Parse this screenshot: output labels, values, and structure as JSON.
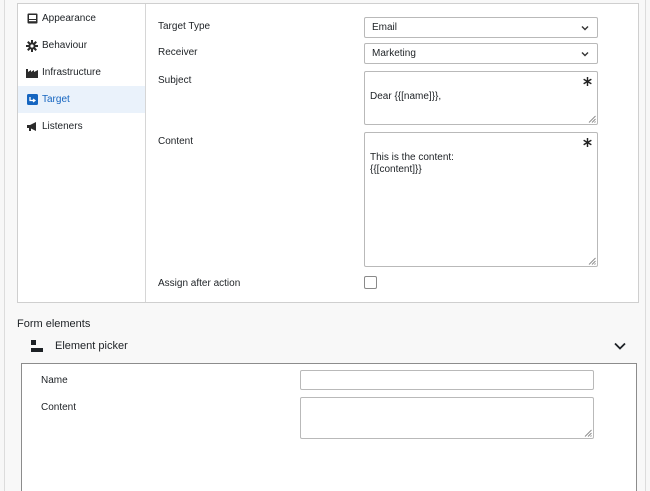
{
  "sidebar": {
    "items": [
      {
        "label": "Appearance",
        "icon": "appearance-icon",
        "active": false
      },
      {
        "label": "Behaviour",
        "icon": "gear-icon",
        "active": false
      },
      {
        "label": "Infrastructure",
        "icon": "factory-icon",
        "active": false
      },
      {
        "label": "Target",
        "icon": "target-arrow-icon",
        "active": true
      },
      {
        "label": "Listeners",
        "icon": "megaphone-icon",
        "active": false
      }
    ]
  },
  "form": {
    "target_type": {
      "label": "Target Type",
      "value": "Email"
    },
    "receiver": {
      "label": "Receiver",
      "value": "Marketing"
    },
    "subject": {
      "label": "Subject",
      "value": "Dear {{[name]}},",
      "required": true
    },
    "content": {
      "label": "Content",
      "value": "This is the content:\n{{[content]}}",
      "required": true
    },
    "assign_after_action": {
      "label": "Assign after action",
      "checked": false
    }
  },
  "form_elements": {
    "title": "Form elements",
    "picker": {
      "label": "Element picker",
      "expanded": true,
      "fields": {
        "name": {
          "label": "Name",
          "value": ""
        },
        "content": {
          "label": "Content",
          "value": ""
        }
      }
    }
  },
  "colors": {
    "accent": "#1565c0",
    "active_bg": "#eaf2fb"
  }
}
